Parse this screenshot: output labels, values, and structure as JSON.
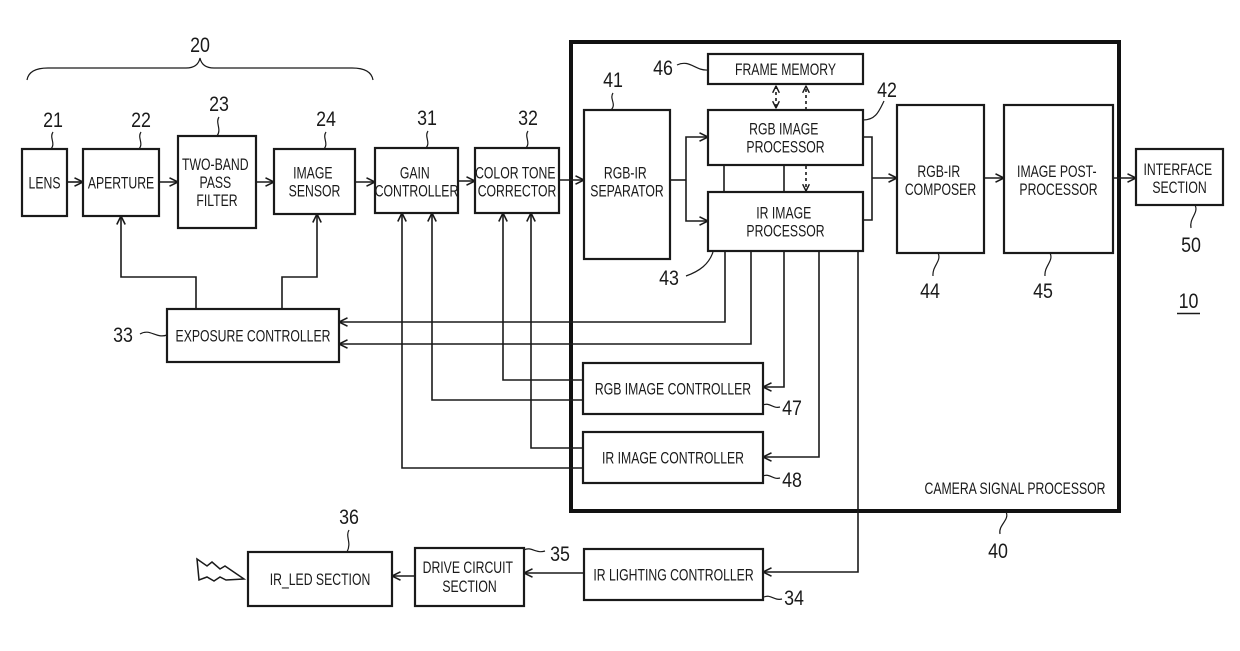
{
  "figure": {
    "ref": "10"
  },
  "optical_block": {
    "ref": "20"
  },
  "blocks": {
    "lens": {
      "lines": [
        "LENS"
      ],
      "ref": "21"
    },
    "aperture": {
      "lines": [
        "APERTURE"
      ],
      "ref": "22"
    },
    "two_band_pass_filter": {
      "lines": [
        "TWO-BAND",
        "PASS",
        "FILTER"
      ],
      "ref": "23"
    },
    "image_sensor": {
      "lines": [
        "IMAGE",
        "SENSOR"
      ],
      "ref": "24"
    },
    "gain_controller": {
      "lines": [
        "GAIN",
        "CONTROLLER"
      ],
      "ref": "31"
    },
    "color_tone_corrector": {
      "lines": [
        "COLOR TONE",
        "CORRECTOR"
      ],
      "ref": "32"
    },
    "exposure_controller": {
      "lines": [
        "EXPOSURE CONTROLLER"
      ],
      "ref": "33"
    },
    "ir_lighting_controller": {
      "lines": [
        "IR LIGHTING CONTROLLER"
      ],
      "ref": "34"
    },
    "drive_circuit_section": {
      "lines": [
        "DRIVE CIRCUIT",
        "SECTION"
      ],
      "ref": "35"
    },
    "ir_led_section": {
      "lines": [
        "IR_LED SECTION"
      ],
      "ref": "36"
    },
    "camera_signal_processor": {
      "lines": [
        "CAMERA SIGNAL PROCESSOR"
      ],
      "ref": "40"
    },
    "rgb_ir_separator": {
      "lines": [
        "RGB-IR",
        "SEPARATOR"
      ],
      "ref": "41"
    },
    "rgb_image_processor": {
      "lines": [
        "RGB IMAGE",
        "PROCESSOR"
      ],
      "ref": "42"
    },
    "ir_image_processor": {
      "lines": [
        "IR IMAGE",
        "PROCESSOR"
      ],
      "ref": "43"
    },
    "rgb_ir_composer": {
      "lines": [
        "RGB-IR",
        "COMPOSER"
      ],
      "ref": "44"
    },
    "image_post_processor": {
      "lines": [
        "IMAGE POST-",
        "PROCESSOR"
      ],
      "ref": "45"
    },
    "frame_memory": {
      "lines": [
        "FRAME MEMORY"
      ],
      "ref": "46"
    },
    "rgb_image_controller": {
      "lines": [
        "RGB IMAGE CONTROLLER"
      ],
      "ref": "47"
    },
    "ir_image_controller": {
      "lines": [
        "IR IMAGE CONTROLLER"
      ],
      "ref": "48"
    },
    "interface_section": {
      "lines": [
        "INTERFACE",
        "SECTION"
      ],
      "ref": "50"
    }
  },
  "icons": {
    "ir_emission": "lightning-bolt-icon"
  },
  "colors": {
    "ink": "#1a1a1a",
    "background": "#ffffff"
  }
}
